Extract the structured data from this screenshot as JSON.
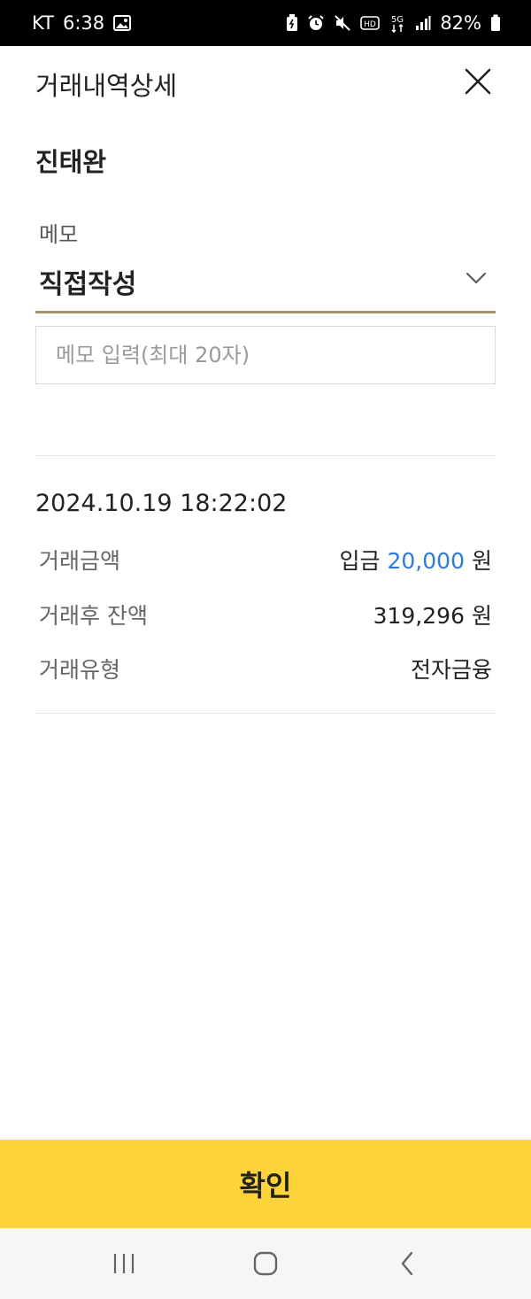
{
  "status_bar": {
    "carrier": "KT",
    "time": "6:38",
    "network": "5G",
    "battery": "82%",
    "icons": [
      "gallery-icon",
      "battery-saver-icon",
      "alarm-icon",
      "mute-icon",
      "hd-icon",
      "network-5g-icon",
      "signal-icon",
      "battery-icon"
    ]
  },
  "header": {
    "title": "거래내역상세"
  },
  "payee": {
    "name": "진태완"
  },
  "memo": {
    "label": "메모",
    "selected": "직접작성",
    "input_value": "",
    "placeholder": "메모 입력(최대 20자)"
  },
  "transaction": {
    "datetime": "2024.10.19 18:22:02",
    "amount_label": "거래금액",
    "amount_type": "입금",
    "amount": "20,000",
    "amount_unit": "원",
    "balance_label": "거래후 잔액",
    "balance": "319,296",
    "balance_unit": "원",
    "type_label": "거래유형",
    "type": "전자금융"
  },
  "confirm_label": "확인",
  "colors": {
    "accent_yellow": "#ffd43b",
    "underline_gold": "#a89369",
    "amount_blue": "#2d7bd6"
  }
}
